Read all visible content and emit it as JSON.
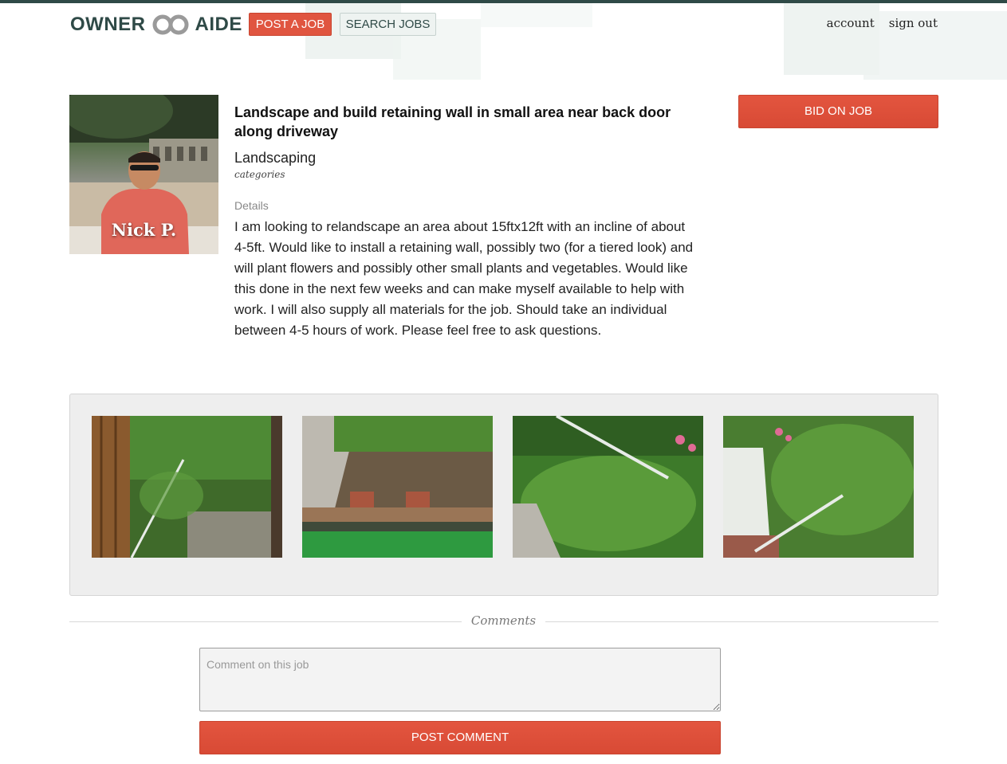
{
  "brand": {
    "left": "OWNER",
    "right": "AIDE",
    "color": "#2f4a47"
  },
  "header": {
    "post_job": "POST A JOB",
    "search_jobs": "SEARCH JOBS",
    "account": "account",
    "sign_out": "sign out"
  },
  "poster": {
    "name": "Nick P."
  },
  "job": {
    "title": "Landscape and build retaining wall in small area near back door along driveway",
    "category": "Landscaping",
    "category_label": "categories",
    "details_label": "Details",
    "details": "I am looking to relandscape an area about 15ftx12ft with an incline of about 4-5ft. Would like to install a retaining wall, possibly two (for a tiered look) and will plant flowers and possibly other small plants and vegetables. Would like this done in the next few weeks and can make myself available to help with work. I will also supply all materials for the job. Should take an individual between 4-5 hours of work. Please feel free to ask questions."
  },
  "actions": {
    "bid": "BID ON JOB"
  },
  "photos": [
    {
      "name": "job-photo-1"
    },
    {
      "name": "job-photo-2"
    },
    {
      "name": "job-photo-3"
    },
    {
      "name": "job-photo-4"
    }
  ],
  "comments": {
    "heading": "Comments",
    "placeholder": "Comment on this job",
    "submit": "POST COMMENT"
  },
  "colors": {
    "accent": "#e05540",
    "brand": "#2f4a47"
  }
}
